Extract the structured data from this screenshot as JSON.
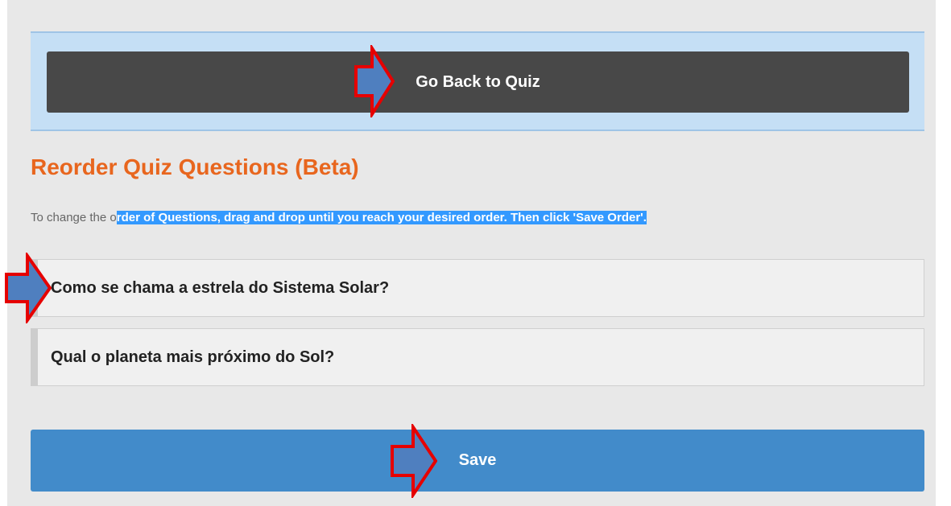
{
  "header": {
    "back_button_label": "Go Back to Quiz"
  },
  "page": {
    "title": "Reorder Quiz Questions (Beta)",
    "instructions_plain": "To change the o",
    "instructions_selected": "rder of Questions, drag and drop until you reach your desired order. Then click 'Save Order'."
  },
  "questions": [
    {
      "label": "Como se chama a estrela do Sistema Solar?"
    },
    {
      "label": "Qual o planeta mais próximo do Sol?"
    }
  ],
  "footer": {
    "save_label": "Save"
  },
  "colors": {
    "accent_title": "#e8661e",
    "save_button": "#428bca",
    "back_button": "#484848",
    "selection_highlight": "#3399ff",
    "annotation_arrow": "#e60000"
  },
  "annotations": {
    "icon": "red-outlined-arrow-icon"
  }
}
